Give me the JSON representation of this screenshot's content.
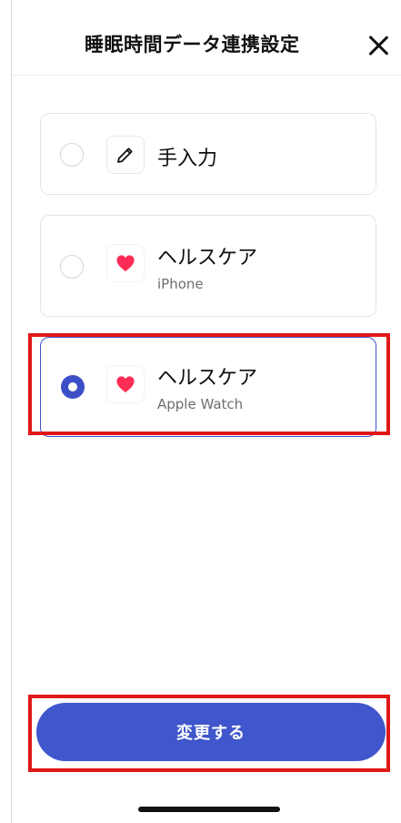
{
  "header": {
    "title": "睡眠時間データ連携設定"
  },
  "options": [
    {
      "label": "手入力",
      "sublabel": "",
      "icon": "pencil-icon",
      "selected": false
    },
    {
      "label": "ヘルスケア",
      "sublabel": "iPhone",
      "icon": "heart-icon",
      "selected": false
    },
    {
      "label": "ヘルスケア",
      "sublabel": "Apple Watch",
      "icon": "heart-icon",
      "selected": true
    }
  ],
  "action": {
    "submit_label": "変更する"
  },
  "colors": {
    "accent": "#3f56cc",
    "heart": "#ff2d55",
    "highlight": "#e11818"
  }
}
